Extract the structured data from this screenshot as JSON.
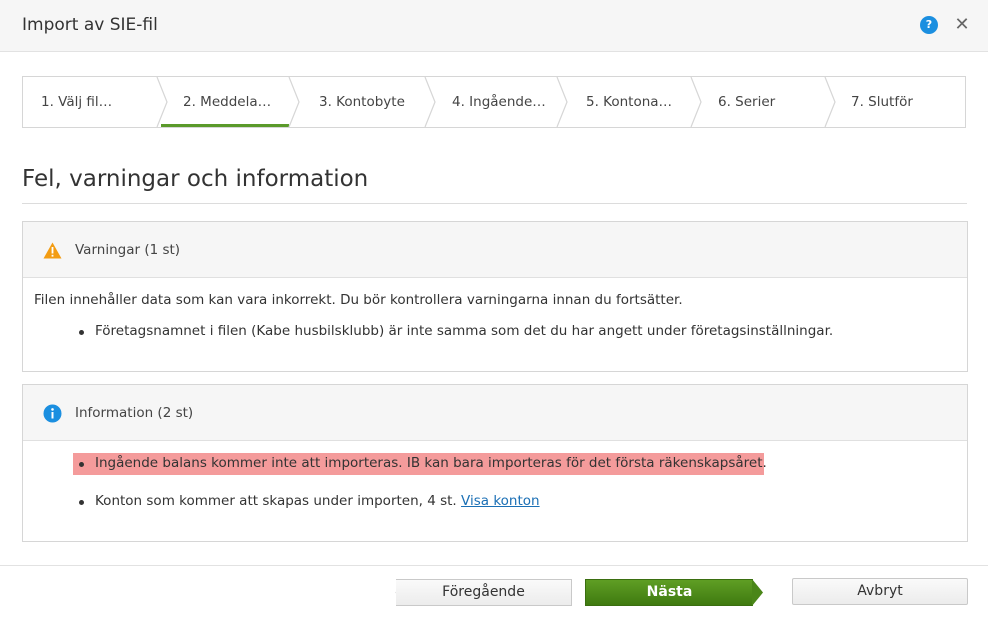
{
  "dialog": {
    "title": "Import av SIE-fil",
    "help_icon": "question-circle-icon",
    "help_glyph": "?",
    "close_icon": "close-icon",
    "close_glyph": "✕"
  },
  "wizard": {
    "active_step": 2,
    "accent_color": "#5a9a2a",
    "steps": [
      {
        "label": "1. Välj fil…"
      },
      {
        "label": "2. Meddela…"
      },
      {
        "label": "3. Kontobyte"
      },
      {
        "label": "4. Ingående…"
      },
      {
        "label": "5. Kontona…"
      },
      {
        "label": "6. Serier"
      },
      {
        "label": "7. Slutför"
      }
    ]
  },
  "page": {
    "title": "Fel, varningar och information"
  },
  "warnings": {
    "icon": "warning-triangle-icon",
    "icon_color": "#f39c12",
    "header": "Varningar (1 st)",
    "intro": "Filen innehåller data som kan vara inkorrekt. Du bör kontrollera varningarna innan du fortsätter.",
    "items": [
      "Företagsnamnet i filen (Kabe husbilsklubb) är inte samma som det du har angett under företagsinställningar."
    ]
  },
  "information": {
    "icon": "info-circle-icon",
    "icon_color": "#1b8fe0",
    "header": "Information (2 st)",
    "items": [
      {
        "text": "Ingående balans kommer inte att importeras. IB kan bara importeras för det första räkenskapsåret.",
        "highlight_color": "#f49b9b"
      },
      {
        "text": "Konton som kommer att skapas under importen, 4 st.",
        "link_label": "Visa konton"
      }
    ]
  },
  "buttons": {
    "previous": "Föregående",
    "next": "Nästa",
    "cancel": "Avbryt",
    "next_color": "#4e8c1a"
  }
}
